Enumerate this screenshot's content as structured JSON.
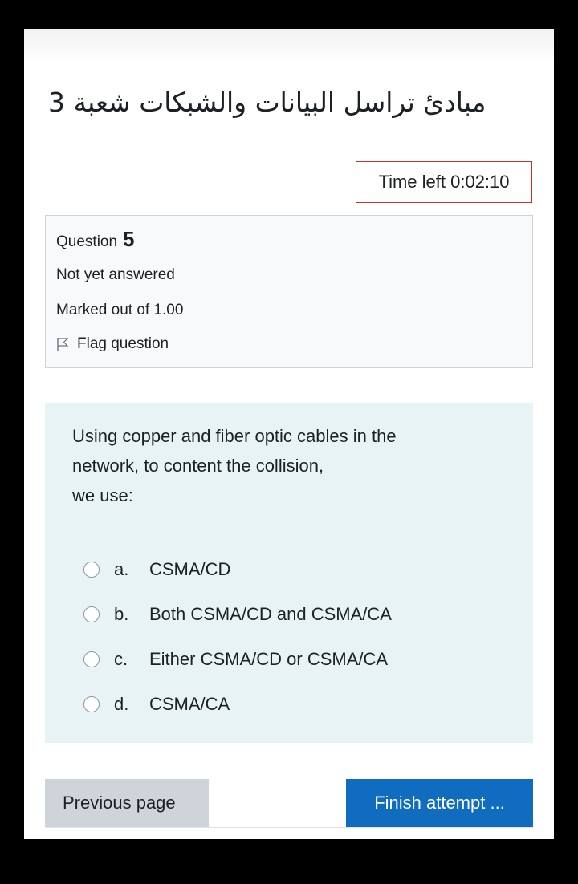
{
  "course": {
    "title": "مبادئ تراسل البيانات والشبكات شعبة 3"
  },
  "timer": {
    "text": "Time left 0:02:10"
  },
  "question_info": {
    "label": "Question",
    "number": "5",
    "status": "Not yet answered",
    "marks": "Marked out of 1.00",
    "flag_label": "Flag question",
    "flag_icon": "flag-icon"
  },
  "question": {
    "lines": [
      "Using copper and fiber optic cables in the",
      "network, to content the collision,",
      "we use:"
    ],
    "answers": [
      {
        "letter": "a.",
        "text": "CSMA/CD",
        "selected": false
      },
      {
        "letter": "b.",
        "text": "Both CSMA/CD and CSMA/CA",
        "selected": false
      },
      {
        "letter": "c.",
        "text": "Either CSMA/CD or CSMA/CA",
        "selected": false
      },
      {
        "letter": "d.",
        "text": "CSMA/CA",
        "selected": false
      }
    ]
  },
  "navigation": {
    "previous_label": "Previous page",
    "finish_label": "Finish attempt ..."
  },
  "colors": {
    "timer_border": "#c9302c",
    "info_background": "#f8f9fa",
    "question_background": "#e7f3f5",
    "primary_button": "#0f6cbf",
    "secondary_button": "#ced4da"
  }
}
